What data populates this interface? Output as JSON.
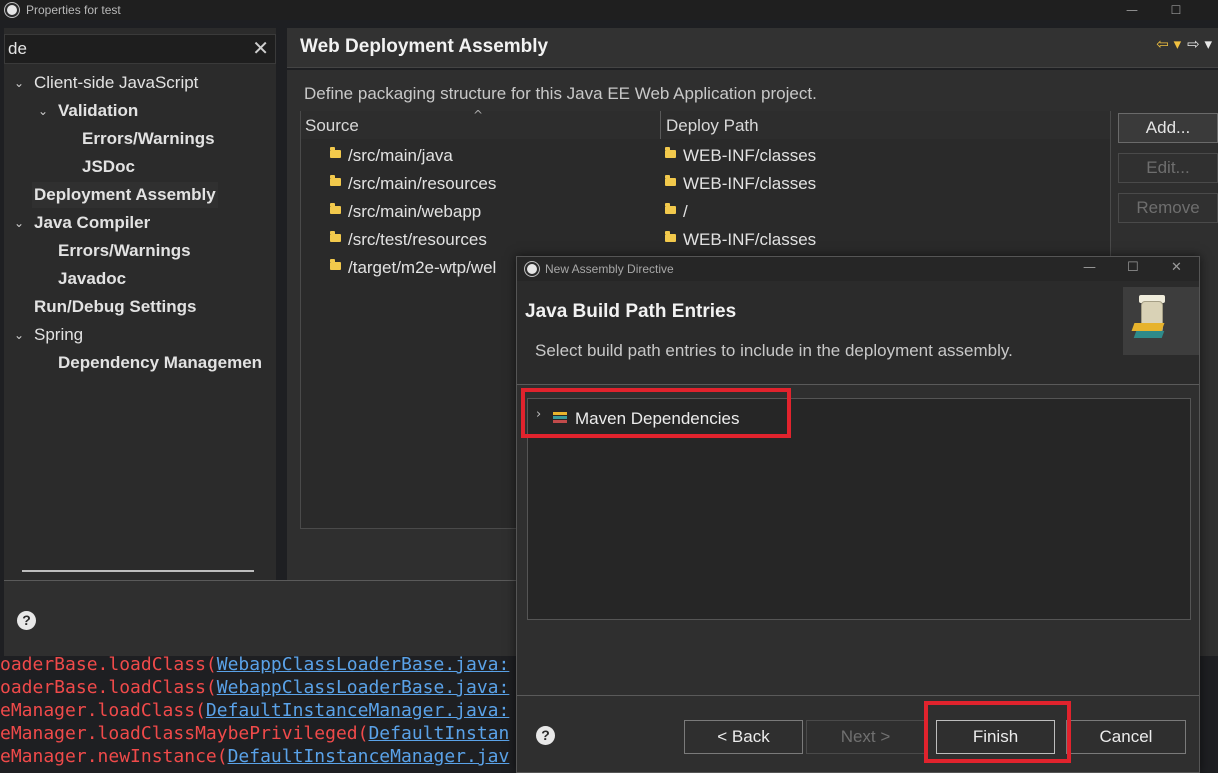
{
  "window": {
    "title": "Properties for test",
    "minimize": "—",
    "maximize": "☐"
  },
  "filter": {
    "value": "de",
    "clear": "✕"
  },
  "tree": [
    {
      "label": "Client-side JavaScript",
      "chev": "⌄"
    },
    {
      "label": "Validation",
      "chev": "⌄"
    },
    {
      "label": "Errors/Warnings"
    },
    {
      "label": "JSDoc"
    },
    {
      "label": "Deployment Assembly"
    },
    {
      "label": "Java Compiler",
      "chev": "⌄"
    },
    {
      "label": "Errors/Warnings"
    },
    {
      "label": "Javadoc"
    },
    {
      "label": "Run/Debug Settings"
    },
    {
      "label": "Spring",
      "chev": "⌄"
    },
    {
      "label": "Dependency Managemen"
    }
  ],
  "page": {
    "title": "Web Deployment Assembly",
    "description": "Define packaging structure for this Java EE Web Application project.",
    "nav_back": "⇦ ▾",
    "nav_fwd": "⇨ ▾"
  },
  "table": {
    "col_source": "Source",
    "col_deploy": "Deploy Path",
    "sort_indicator": "^",
    "rows": [
      {
        "source": "/src/main/java",
        "deploy": "WEB-INF/classes"
      },
      {
        "source": "/src/main/resources",
        "deploy": "WEB-INF/classes"
      },
      {
        "source": "/src/main/webapp",
        "deploy": "/"
      },
      {
        "source": "/src/test/resources",
        "deploy": "WEB-INF/classes"
      },
      {
        "source": "/target/m2e-wtp/wel",
        "deploy": ""
      }
    ]
  },
  "buttons": {
    "add": "Add...",
    "edit": "Edit...",
    "remove": "Remove"
  },
  "help": "?",
  "console": [
    {
      "red": "oaderBase.loadClass(",
      "link": "WebappClassLoaderBase.java:"
    },
    {
      "red": "oaderBase.loadClass(",
      "link": "WebappClassLoaderBase.java:"
    },
    {
      "red": "eManager.loadClass(",
      "link": "DefaultInstanceManager.java:"
    },
    {
      "red": "eManager.loadClassMaybePrivileged(",
      "link": "DefaultInstan"
    },
    {
      "red": "eManager.newInstance(",
      "link": "DefaultInstanceManager.jav"
    },
    {
      "red": "  ...  ",
      "link": ""
    }
  ],
  "dialog": {
    "title": "New Assembly Directive",
    "minimize": "—",
    "maximize": "☐",
    "close": "✕",
    "header_title": "Java Build Path Entries",
    "header_desc": "Select build path entries to include in the deployment assembly.",
    "entry": "Maven Dependencies",
    "entry_chev": "›",
    "back": "< Back",
    "next": "Next >",
    "finish": "Finish",
    "cancel": "Cancel"
  },
  "colors": {
    "highlight": "#e1232d",
    "folder": "#f2c94c",
    "console_red": "#f04a4a",
    "console_link": "#5aa2e8"
  }
}
